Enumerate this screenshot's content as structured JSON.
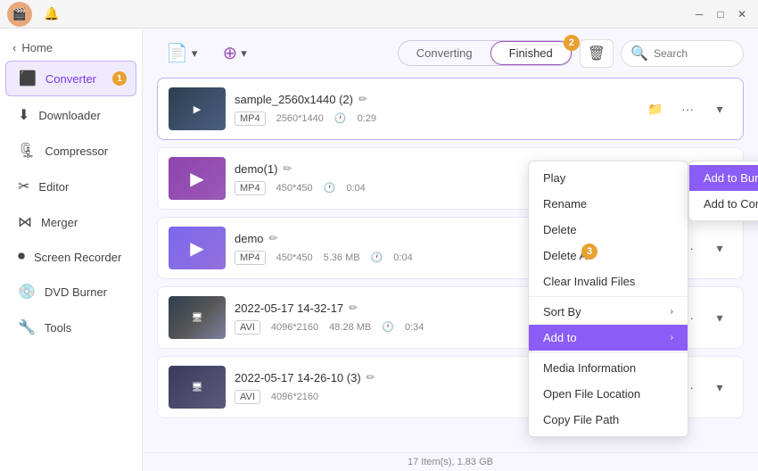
{
  "titlebar": {
    "controls": [
      "minimize",
      "maximize",
      "close"
    ]
  },
  "sidebar": {
    "back_label": "Home",
    "items": [
      {
        "id": "converter",
        "label": "Converter",
        "icon": "⬛",
        "active": true,
        "badge": "1"
      },
      {
        "id": "downloader",
        "label": "Downloader",
        "icon": "⬇"
      },
      {
        "id": "compressor",
        "label": "Compressor",
        "icon": "🗜"
      },
      {
        "id": "editor",
        "label": "Editor",
        "icon": "✂"
      },
      {
        "id": "merger",
        "label": "Merger",
        "icon": "⋈"
      },
      {
        "id": "screen-recorder",
        "label": "Screen Recorder",
        "icon": "⏺"
      },
      {
        "id": "dvd-burner",
        "label": "DVD Burner",
        "icon": "💿"
      },
      {
        "id": "tools",
        "label": "Tools",
        "icon": "🔧"
      }
    ]
  },
  "toolbar": {
    "add_label": "+",
    "settings_label": "⚙",
    "tabs": [
      {
        "id": "converting",
        "label": "Converting"
      },
      {
        "id": "finished",
        "label": "Finished",
        "active": true,
        "badge": "2"
      }
    ],
    "trash_label": "🗑",
    "search_placeholder": "Search"
  },
  "files": [
    {
      "id": "file1",
      "name": "sample_2560x1440 (2)",
      "thumb_type": "sample",
      "format": "MP4",
      "resolution": "2560*1440",
      "size": "",
      "duration": "0:29",
      "highlighted": true
    },
    {
      "id": "file2",
      "name": "demo(1)",
      "thumb_type": "demo",
      "format": "MP4",
      "resolution": "450*450",
      "size": "",
      "duration": "0:04"
    },
    {
      "id": "file3",
      "name": "demo",
      "thumb_type": "demo2",
      "format": "MP4",
      "resolution": "450*450",
      "size": "5.36 MB",
      "duration": "0:04"
    },
    {
      "id": "file4",
      "name": "2022-05-17 14-32-17",
      "thumb_type": "2022a",
      "format": "AVI",
      "resolution": "4096*2160",
      "size": "48.28 MB",
      "duration": "0:34"
    },
    {
      "id": "file5",
      "name": "2022-05-17 14-26-10 (3)",
      "thumb_type": "2022b",
      "format": "AVI",
      "resolution": "4096*2160",
      "size": "",
      "duration": ""
    }
  ],
  "context_menu": {
    "items": [
      {
        "id": "play",
        "label": "Play"
      },
      {
        "id": "rename",
        "label": "Rename"
      },
      {
        "id": "delete",
        "label": "Delete"
      },
      {
        "id": "delete-all",
        "label": "Delete All"
      },
      {
        "id": "clear-invalid",
        "label": "Clear Invalid Files"
      },
      {
        "id": "sort-by",
        "label": "Sort By",
        "has_arrow": true
      },
      {
        "id": "add-to",
        "label": "Add to",
        "has_arrow": true,
        "active": true
      },
      {
        "id": "media-info",
        "label": "Media Information"
      },
      {
        "id": "open-file",
        "label": "Open File Location"
      },
      {
        "id": "copy-path",
        "label": "Copy File Path"
      }
    ]
  },
  "submenu": {
    "items": [
      {
        "id": "burn-list",
        "label": "Add to Burn List",
        "active": true
      },
      {
        "id": "compress-list",
        "label": "Add to Compress List"
      }
    ]
  },
  "statusbar": {
    "text": "17 Item(s), 1.83 GB"
  },
  "badges": {
    "b1": "1",
    "b2": "2",
    "b3": "3"
  }
}
